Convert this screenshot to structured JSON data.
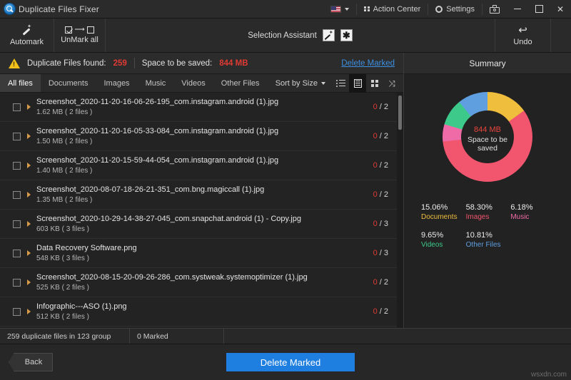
{
  "titlebar": {
    "app_icon": "magnifier-logo-icon",
    "title": "Duplicate Files Fixer",
    "language_flag": "us-flag-icon",
    "action_center": "Action Center",
    "settings": "Settings",
    "screenshot_icon": "camera-icon",
    "minimize": "—",
    "maximize": "□",
    "close": "✕"
  },
  "toolbar": {
    "automark": "Automark",
    "unmark_all": "UnMark all",
    "selection_assistant": "Selection Assistant",
    "sa_wand_icon": "magic-wand-icon",
    "sa_star_icon": "asterisk-star-icon",
    "undo": "Undo",
    "undo_icon": "undo-arrow-icon"
  },
  "infobar": {
    "warning_icon": "warning-triangle-icon",
    "found_label": "Duplicate Files found:",
    "found_value": "259",
    "space_label": "Space to be saved:",
    "space_value": "844 MB",
    "delete_marked_link": "Delete Marked"
  },
  "tabs": {
    "items": [
      {
        "label": "All files",
        "active": true
      },
      {
        "label": "Documents",
        "active": false
      },
      {
        "label": "Images",
        "active": false
      },
      {
        "label": "Music",
        "active": false
      },
      {
        "label": "Videos",
        "active": false
      },
      {
        "label": "Other Files",
        "active": false
      }
    ],
    "sort_by": "Sort by Size",
    "view_modes": [
      {
        "icon": "list-view-icon",
        "selected": false
      },
      {
        "icon": "detail-view-icon",
        "selected": true
      },
      {
        "icon": "grid-view-icon",
        "selected": false
      },
      {
        "icon": "expand-view-icon",
        "selected": false
      }
    ]
  },
  "file_list": {
    "rows": [
      {
        "name": "Screenshot_2020-11-20-16-06-26-195_com.instagram.android (1).jpg",
        "sub": "1.62 MB  ( 2 files )",
        "marked": "0",
        "total": "2"
      },
      {
        "name": "Screenshot_2020-11-20-16-05-33-084_com.instagram.android (1).jpg",
        "sub": "1.50 MB  ( 2 files )",
        "marked": "0",
        "total": "2"
      },
      {
        "name": "Screenshot_2020-11-20-15-59-44-054_com.instagram.android (1).jpg",
        "sub": "1.40 MB  ( 2 files )",
        "marked": "0",
        "total": "2"
      },
      {
        "name": "Screenshot_2020-08-07-18-26-21-351_com.bng.magiccall (1).jpg",
        "sub": "1.35 MB  ( 2 files )",
        "marked": "0",
        "total": "2"
      },
      {
        "name": "Screenshot_2020-10-29-14-38-27-045_com.snapchat.android (1) - Copy.jpg",
        "sub": "603 KB  ( 3 files )",
        "marked": "0",
        "total": "3"
      },
      {
        "name": "Data Recovery Software.png",
        "sub": "548 KB  ( 3 files )",
        "marked": "0",
        "total": "3"
      },
      {
        "name": "Screenshot_2020-08-15-20-09-26-286_com.systweak.systemoptimizer (1).jpg",
        "sub": "525 KB  ( 2 files )",
        "marked": "0",
        "total": "2"
      },
      {
        "name": "Infographic---ASO (1).png",
        "sub": "512 KB  ( 2 files )",
        "marked": "0",
        "total": "2"
      }
    ]
  },
  "summary": {
    "heading": "Summary",
    "center_value": "844",
    "center_unit": "MB",
    "center_caption_line1": "Space to be",
    "center_caption_line2": "saved"
  },
  "chart_data": {
    "type": "pie",
    "title": "Summary",
    "subtitle": "844 MB Space to be saved",
    "categories": [
      "Documents",
      "Images",
      "Music",
      "Videos",
      "Other Files"
    ],
    "values": [
      15.06,
      58.3,
      6.18,
      9.65,
      10.81
    ],
    "unit": "%",
    "colors": [
      "#efbe3d",
      "#f2556e",
      "#ef6ba8",
      "#3cc98a",
      "#5f9fe0"
    ],
    "legend_position": "below",
    "donut": true,
    "center_label": "844 MB Space to be saved"
  },
  "statusbar": {
    "files_text": "259 duplicate files in 123 group",
    "marked_text": "0 Marked"
  },
  "footer": {
    "back": "Back",
    "delete_marked": "Delete Marked",
    "watermark": "wsxdn.com"
  }
}
